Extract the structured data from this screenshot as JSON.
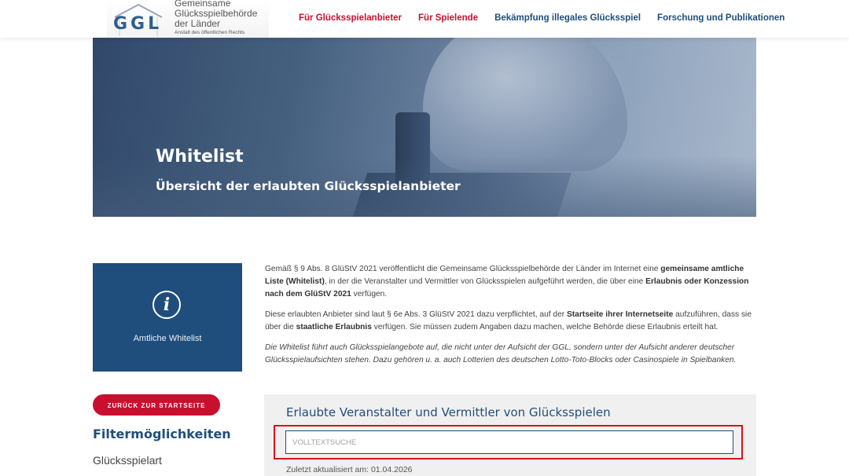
{
  "header": {
    "logo_letters": "GGL",
    "logo_line1": "Gemeinsame",
    "logo_line2": "Glücksspielbehörde",
    "logo_line3": "der Länder",
    "logo_line4": "Anstalt des öffentlichen Rechts",
    "nav": [
      {
        "label": "Für Glücksspielanbieter",
        "color": "#c8102e"
      },
      {
        "label": "Für Spielende",
        "color": "#c8102e"
      },
      {
        "label": "Bekämpfung illegales Glücksspiel",
        "color": "#1f4e7c"
      },
      {
        "label": "Forschung und Publikationen",
        "color": "#1f4e7c"
      }
    ]
  },
  "hero": {
    "title": "Whitelist",
    "subtitle": "Übersicht der erlaubten Glücksspielanbieter"
  },
  "sidebar": {
    "card_icon": "info-icon",
    "card_label": "Amtliche Whitelist",
    "back_button": "ZURÜCK ZUR STARTSEITE",
    "filter_title": "Filtermöglichkeiten",
    "filter_item": "Glücksspielart"
  },
  "content": {
    "p1_a": "Gemäß § 9 Abs. 8 GlüStV 2021 veröffentlicht die Gemeinsame Glücksspielbehörde der Länder im Internet eine ",
    "p1_b": "gemeinsame amtliche Liste (Whitelist)",
    "p1_c": ", in der die Veranstalter und Vermittler von Glücksspielen aufgeführt werden, die über eine ",
    "p1_d": "Erlaubnis oder Konzession nach dem GlüStV 2021",
    "p1_e": " verfügen.",
    "p2_a": "Diese erlaubten Anbieter sind laut § 6e Abs. 3 GlüStV 2021 dazu verpflichtet, auf der ",
    "p2_b": "Startseite ihrer Internetseite",
    "p2_c": " aufzuführen, dass sie über die ",
    "p2_d": "staatliche Erlaubnis",
    "p2_e": " verfügen. Sie müssen zudem Angaben dazu machen, welche Behörde diese Erlaubnis erteilt hat.",
    "p3": "Die Whitelist führt auch Glücksspielangebote auf, die nicht unter der Aufsicht der GGL, sondern unter der Aufsicht anderer deutscher Glücksspielaufsichten stehen. Dazu gehören u. a. auch Lotterien des deutschen Lotto-Toto-Blocks oder Casinospiele in Spielbanken."
  },
  "search": {
    "title": "Erlaubte Veranstalter und Vermittler von Glücksspielen",
    "placeholder": "VOLLTEXTSUCHE",
    "value": "",
    "updated": "Zuletzt aktualisiert am: 01.04.2026",
    "highlight_color": "#d6131d"
  }
}
